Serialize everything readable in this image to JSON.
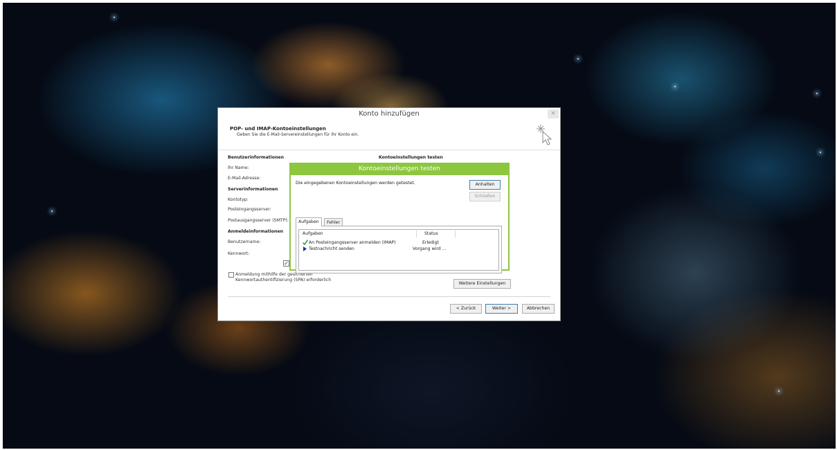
{
  "dialog": {
    "title": "Konto hinzufügen",
    "close_label": "×",
    "header_title": "POP- und IMAP-Kontoeinstellungen",
    "header_subtitle": "Geben Sie die E-Mail-Servereinstellungen für Ihr Konto ein.",
    "sections": {
      "user_info": "Benutzerinformationen",
      "server_info": "Serverinformationen",
      "login_info": "Anmeldeinformationen",
      "test_settings": "Kontoeinstellungen testen"
    },
    "labels": {
      "name": "Ihr Name:",
      "email": "E-Mail-Adresse:",
      "account_type": "Kontotyp:",
      "incoming_server": "Posteingangsserver:",
      "outgoing_server": "Postausgangsserver (SMTP):",
      "username": "Benutzername:",
      "password": "Kennwort:"
    },
    "spa_checkbox_line1": "Anmeldung mithilfe der gesicherten",
    "spa_checkbox_line2": "Kennwortauthentifizierung (SPA) erforderlich",
    "more_settings_button": "Weitere Einstellungen",
    "back_button": "< Zurück",
    "next_button": "Weiter >",
    "cancel_button": "Abbrechen"
  },
  "test_dialog": {
    "title": "Kontoeinstellungen testen",
    "message": "Die eingegebenen Kontoeinstellungen werden getestet.",
    "stop_button": "Anhalten",
    "close_button": "Schließen",
    "tabs": [
      "Aufgaben",
      "Fehler"
    ],
    "columns": [
      "Aufgaben",
      "Status"
    ],
    "tasks": [
      {
        "task": "An Posteingangsserver anmelden (IMAP)",
        "status": "Erledigt",
        "icon": "checkmark-icon"
      },
      {
        "task": "Testnachricht senden",
        "status": "Vorgang wird ...",
        "icon": "arrow-right-icon"
      }
    ]
  },
  "colors": {
    "accent_green": "#8dc63f",
    "check_green": "#2a8a2a",
    "arrow_blue": "#1a3a9a"
  }
}
